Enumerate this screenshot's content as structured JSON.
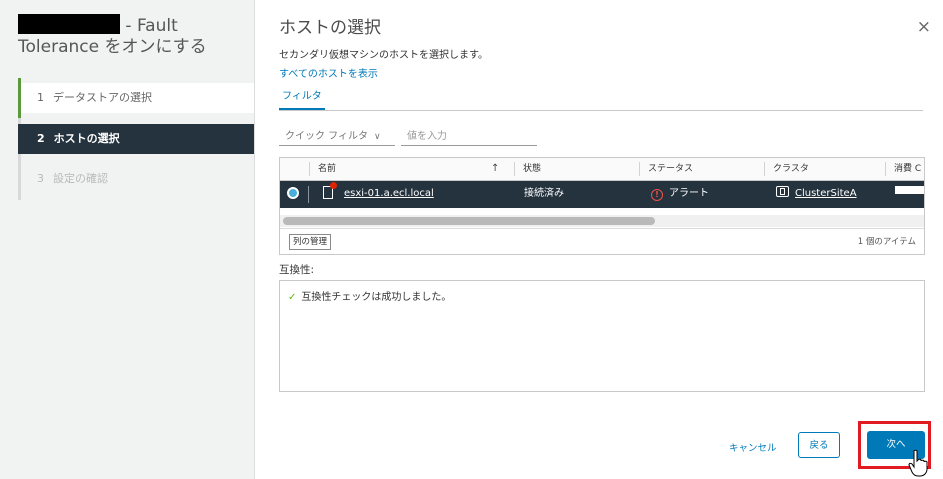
{
  "wizard": {
    "title_suffix": "- Fault",
    "title_line2": "Tolerance をオンにする",
    "steps": [
      {
        "num": "1",
        "label": "データストアの選択"
      },
      {
        "num": "2",
        "label": "ホストの選択"
      },
      {
        "num": "3",
        "label": "設定の確認"
      }
    ]
  },
  "page": {
    "title": "ホストの選択",
    "close": "×",
    "subtitle": "セカンダリ仮想マシンのホストを選択します。",
    "show_all_link": "すべてのホストを表示",
    "tab_filter": "フィルタ",
    "quick_filter": "クイック フィルタ",
    "value_placeholder": "値を入力"
  },
  "grid": {
    "columns": [
      "名前",
      "状態",
      "ステータス",
      "クラスタ",
      "消費 C"
    ],
    "sort_indicator": "↑",
    "rows": [
      {
        "name": "esxi-01.a.ecl.local",
        "state": "接続済み",
        "status": "アラート",
        "cluster": "ClusterSiteA",
        "selected": true
      }
    ],
    "manage_columns": "列の管理",
    "item_count": "1 個のアイテム"
  },
  "compatibility": {
    "label": "互換性:",
    "message": "互換性チェックは成功しました。"
  },
  "footer": {
    "cancel": "キャンセル",
    "back": "戻る",
    "next": "次へ"
  },
  "colors": {
    "accent": "#0079b8",
    "selected_row": "#25333e",
    "highlight_box": "#e11b22",
    "success": "#60b515",
    "alert": "#f54f47"
  }
}
